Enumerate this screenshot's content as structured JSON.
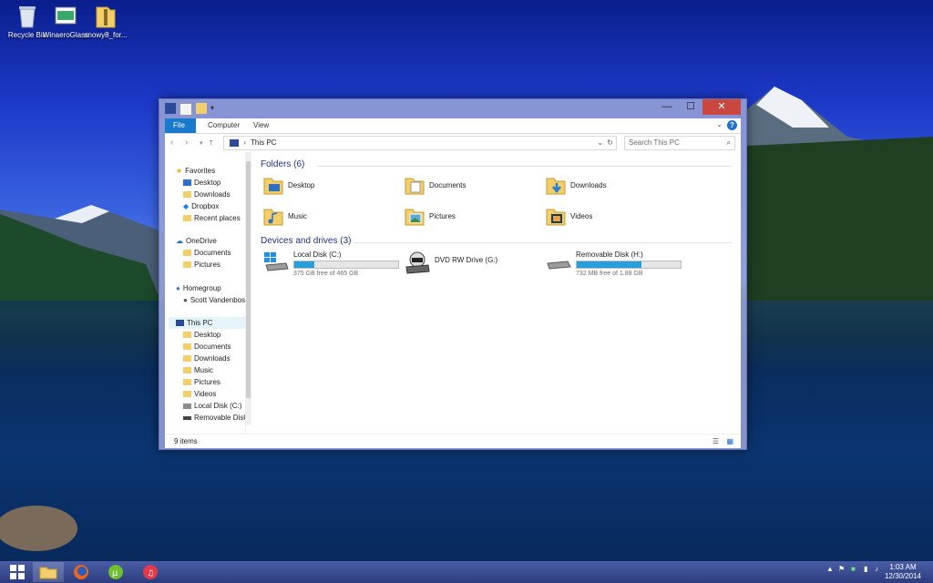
{
  "desktop_icons": [
    {
      "label": "Recycle Bin",
      "icon": "recycle-bin-icon"
    },
    {
      "label": "WinaeroGlass",
      "icon": "application-icon"
    },
    {
      "label": "snowy8_for...",
      "icon": "zip-folder-icon"
    }
  ],
  "explorer": {
    "ribbon_tabs": [
      "File",
      "Computer",
      "View"
    ],
    "address": "This PC",
    "search_placeholder": "Search This PC",
    "status_text": "9 items",
    "nav_pane": {
      "favorites": {
        "label": "Favorites",
        "items": [
          "Desktop",
          "Downloads",
          "Dropbox",
          "Recent places"
        ]
      },
      "onedrive": {
        "label": "OneDrive",
        "items": [
          "Documents",
          "Pictures"
        ]
      },
      "homegroup": {
        "label": "Homegroup",
        "items": [
          "Scott Vandenbos"
        ]
      },
      "thispc": {
        "label": "This PC",
        "items": [
          "Desktop",
          "Documents",
          "Downloads",
          "Music",
          "Pictures",
          "Videos",
          "Local Disk (C:)",
          "Removable Disk"
        ]
      }
    },
    "folders_header": "Folders (6)",
    "folders": [
      "Desktop",
      "Documents",
      "Downloads",
      "Music",
      "Pictures",
      "Videos"
    ],
    "devices_header": "Devices and drives (3)",
    "drives": [
      {
        "name": "Local Disk (C:)",
        "free_text": "375 GB free of 465 GB",
        "used_fraction": 0.19
      },
      {
        "name": "DVD RW Drive (G:)"
      },
      {
        "name": "Removable Disk (H:)",
        "free_text": "732 MB free of 1.88 GB",
        "used_fraction": 0.62
      }
    ]
  },
  "taskbar": {
    "clock_time": "1:03 AM",
    "clock_date": "12/30/2014"
  },
  "colors": {
    "accent": "#1979ca",
    "progress": "#26a0da",
    "close": "#c9473e"
  }
}
